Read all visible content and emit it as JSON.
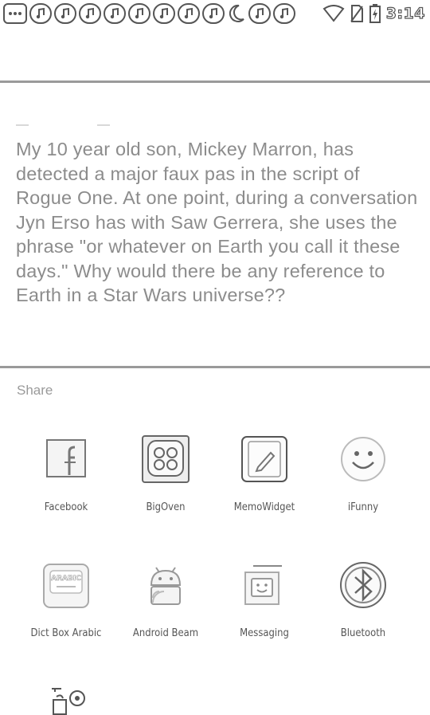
{
  "status_bar": {
    "time": "3:14",
    "notification_icons": [
      "more-icon",
      "music-note-icon",
      "music-note-icon",
      "music-note-icon",
      "music-note-icon",
      "music-note-icon",
      "music-note-icon",
      "music-note-icon",
      "music-note-icon",
      "moon-icon",
      "music-note-icon",
      "music-note-icon"
    ],
    "system_icons": [
      "wifi-icon",
      "no-sim-icon",
      "battery-icon"
    ]
  },
  "message": {
    "text": "My 10 year old son, Mickey Marron, has detected a major faux pas in the script of Rogue One. At one point, during a conversation Jyn Erso has with Saw Gerrera, she uses the phrase \"or whatever on Earth you call it these days.\" Why would there be any reference to Earth in a Star Wars universe??"
  },
  "share": {
    "title": "Share",
    "apps": [
      {
        "label": "Facebook",
        "icon": "facebook-icon"
      },
      {
        "label": "BigOven",
        "icon": "bigoven-icon"
      },
      {
        "label": "MemoWidget",
        "icon": "memo-widget-icon"
      },
      {
        "label": "iFunny",
        "icon": "ifunny-icon"
      },
      {
        "label": "Dict Box Arabic",
        "icon": "dict-box-arabic-icon",
        "icon_text": "ARABIC"
      },
      {
        "label": "Android Beam",
        "icon": "android-beam-icon"
      },
      {
        "label": "Messaging",
        "icon": "messaging-icon"
      },
      {
        "label": "Bluetooth",
        "icon": "bluetooth-icon"
      },
      {
        "label": "",
        "icon": "unknown-app-icon"
      }
    ]
  }
}
